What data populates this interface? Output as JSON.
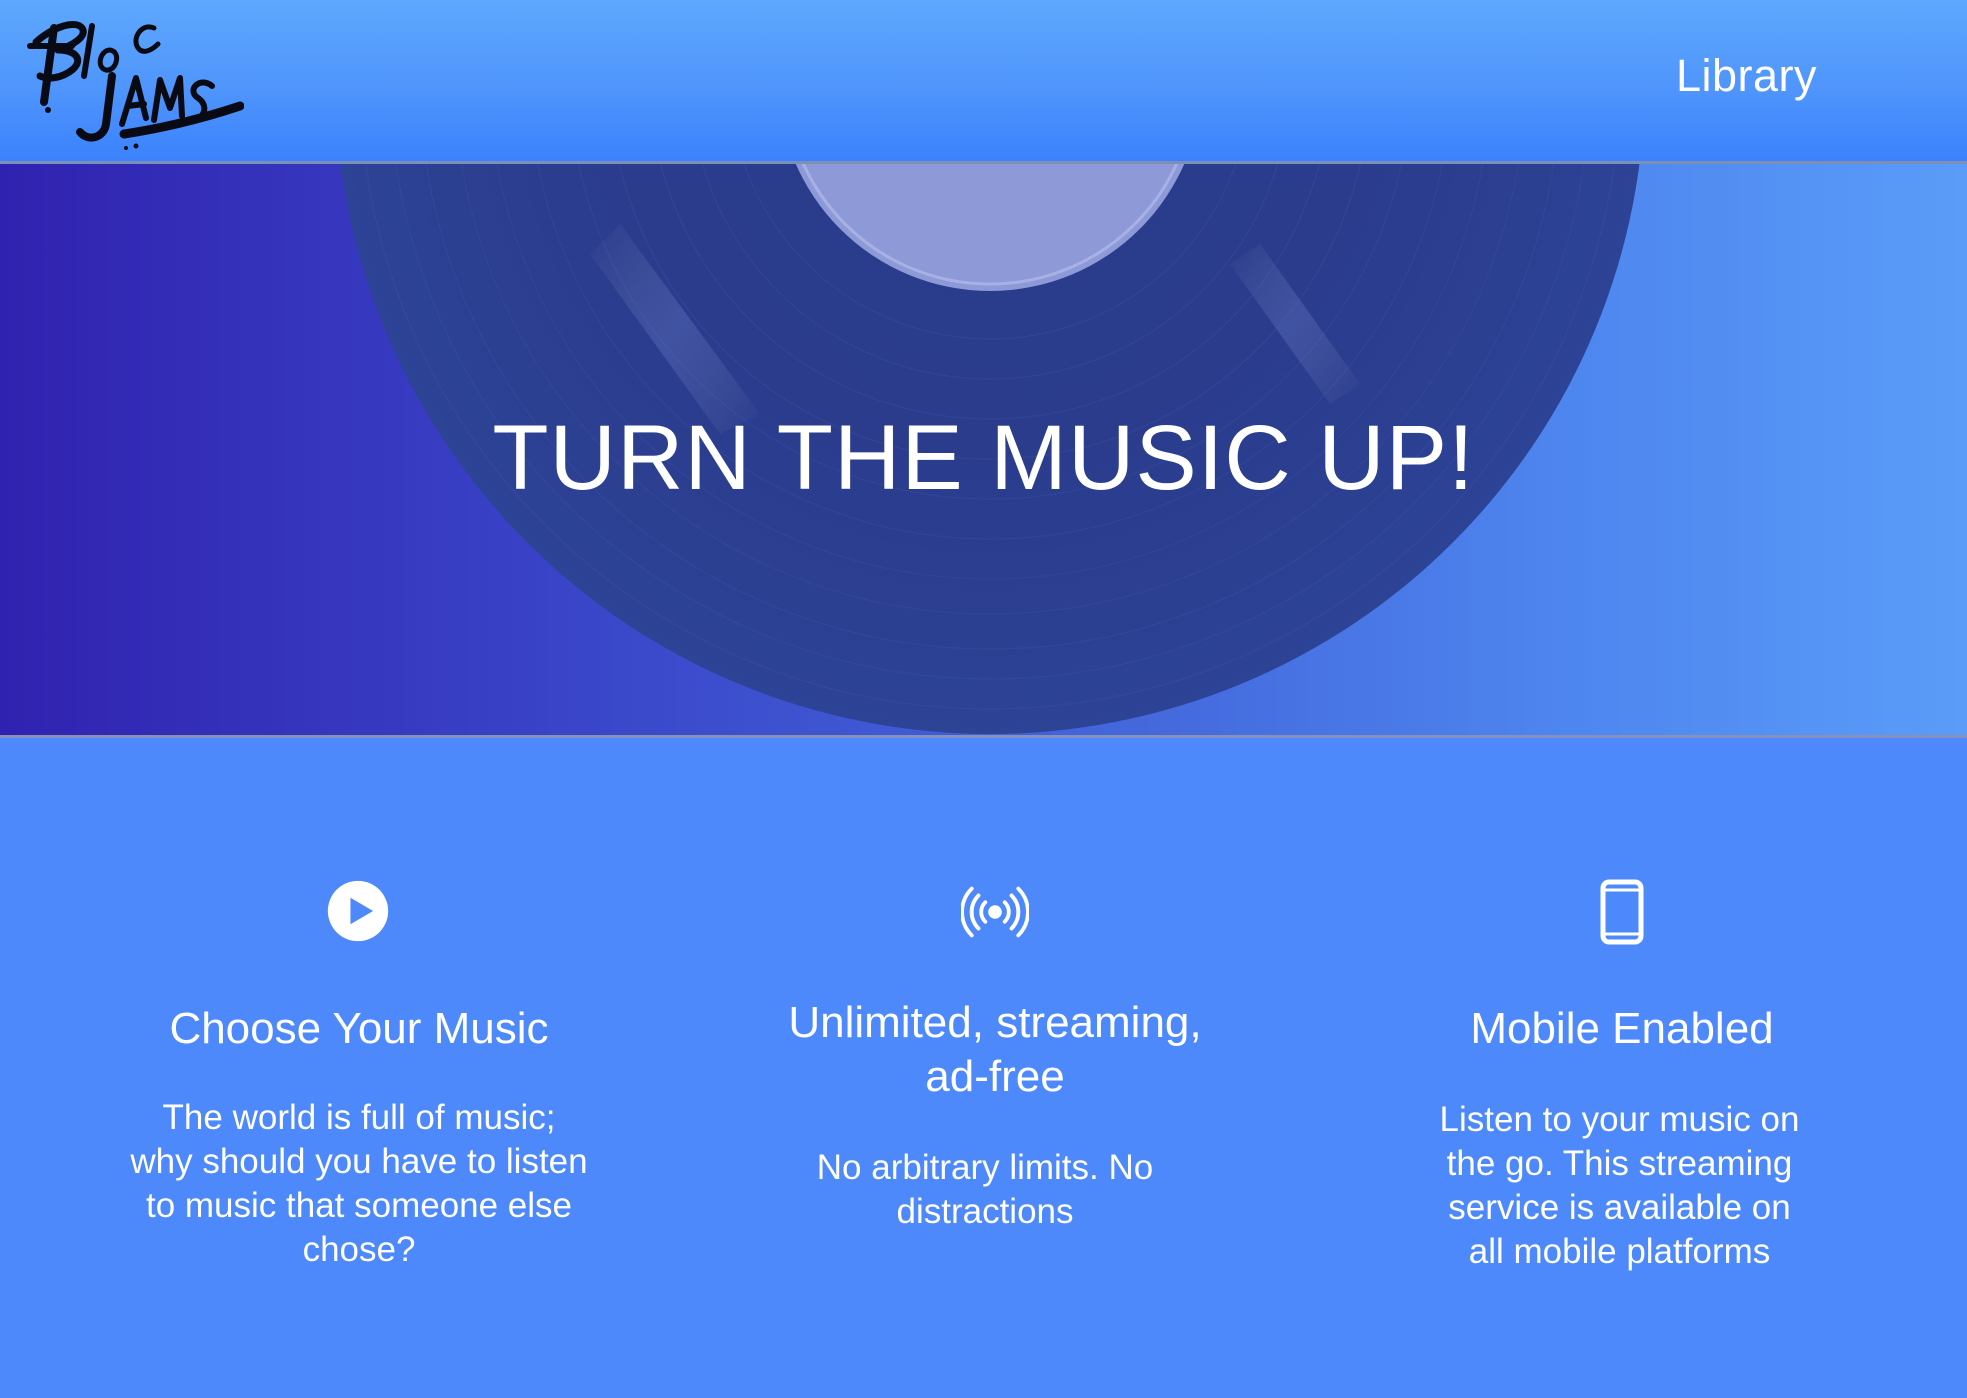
{
  "navbar": {
    "logo_text": "BLOC JAMS",
    "library_link": "Library"
  },
  "hero": {
    "title": "TURN THE MUSIC UP!"
  },
  "selling_points": [
    {
      "icon": "play-circle-icon",
      "title": "Choose Your Music",
      "description": "The world is full of music; why should you have to listen to music that someone else chose?"
    },
    {
      "icon": "broadcast-icon",
      "title": "Unlimited, streaming, ad-free",
      "description": "No arbitrary limits. No distractions"
    },
    {
      "icon": "phone-icon",
      "title": "Mobile Enabled",
      "description": "Listen to your music on the go. This streaming service is available on all mobile platforms"
    }
  ],
  "colors": {
    "navbar": "#4f95fc",
    "page_background": "#4d89fb",
    "hero_left": "#3022b0",
    "hero_right": "#5a9cf8",
    "vinyl": "#2a3c8c",
    "text": "#ffffff"
  }
}
